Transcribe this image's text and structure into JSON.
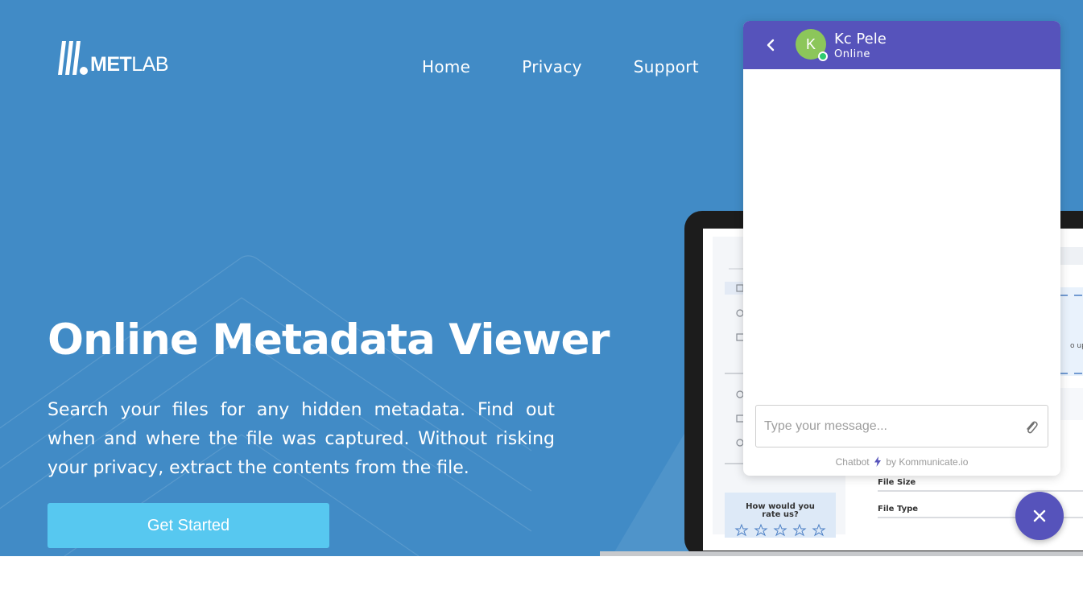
{
  "logo": {
    "bold": "MET",
    "light": "LAB"
  },
  "nav": {
    "items": [
      {
        "label": "Home"
      },
      {
        "label": "Privacy"
      },
      {
        "label": "Support"
      }
    ]
  },
  "hero": {
    "title": "Online Metadata Viewer",
    "description": "Search your files for any hidden metadata. Find out when and where the file was captured. Without risking your privacy, extract the contents from the file.",
    "cta_label": "Get Started",
    "laptop_screen": {
      "rate_title": "How would you rate us?",
      "rate_stars": 5,
      "field_labels": [
        "File Size",
        "File Type"
      ],
      "upload_hint": "o upl"
    }
  },
  "chat": {
    "agent_name": "Kc Pele",
    "agent_initial": "K",
    "agent_status": "Online",
    "input_placeholder": "Type your message...",
    "powered_prefix": "Chatbot",
    "powered_suffix": "by Kommunicate.io"
  },
  "colors": {
    "hero_bg": "#418bc6",
    "cta": "#57c8f0",
    "chat_header": "#5653bb",
    "avatar": "#8cc65a",
    "online": "#2ecc71"
  },
  "icons": {
    "back": "chevron-left-icon",
    "attach": "paperclip-icon",
    "close": "close-icon",
    "bolt": "lightning-icon"
  }
}
